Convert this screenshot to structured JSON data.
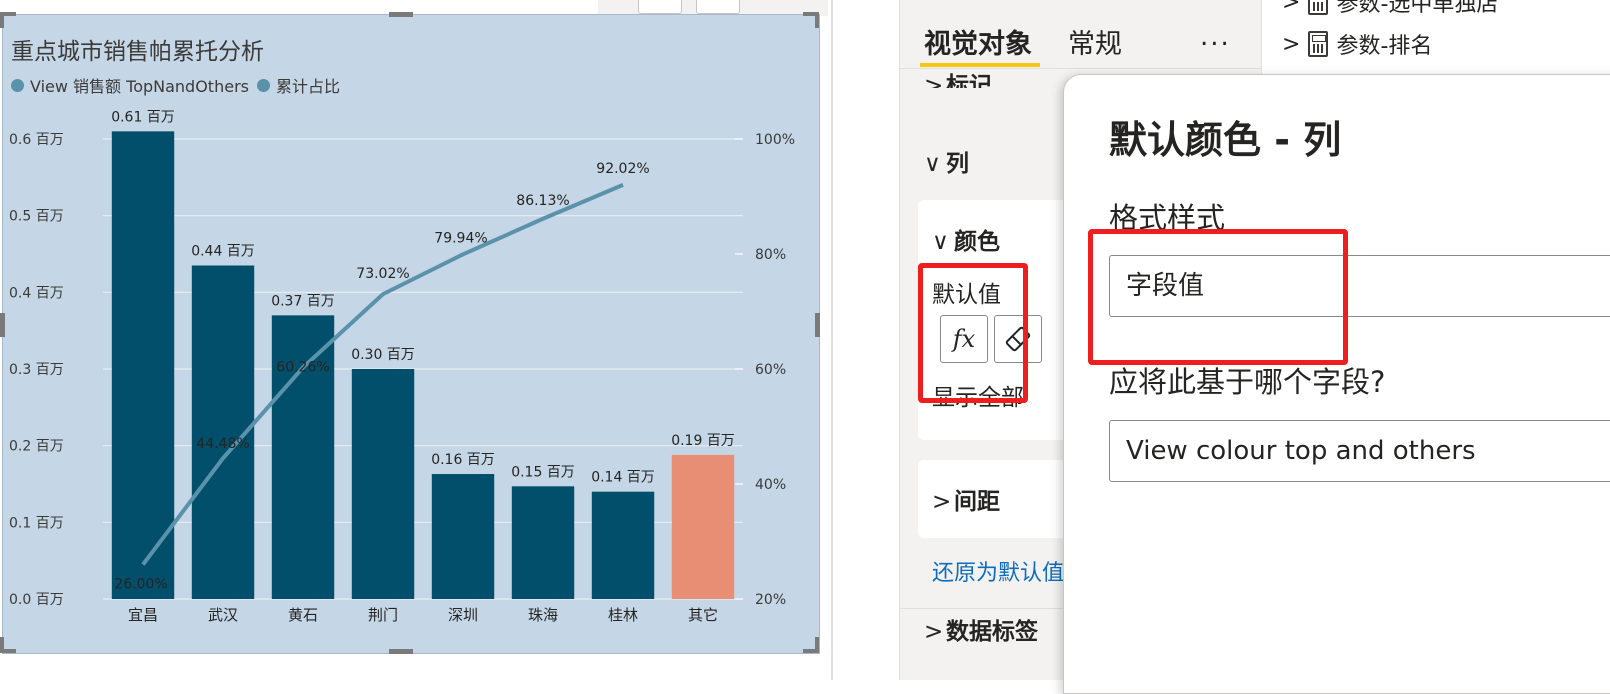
{
  "chart_data": {
    "type": "bar",
    "title": "重点城市销售帕累托分析",
    "categories": [
      "宜昌",
      "武汉",
      "黄石",
      "荆门",
      "深圳",
      "珠海",
      "桂林",
      "其它"
    ],
    "series": [
      {
        "name": "View 销售额 TopNandOthers",
        "values": [
          0.61,
          0.435,
          0.37,
          0.3,
          0.163,
          0.147,
          0.14,
          0.188
        ],
        "data_labels": [
          "0.61 百万",
          "0.44 百万",
          "0.37 百万",
          "0.30 百万",
          "0.16 百万",
          "0.15 百万",
          "0.14 百万",
          "0.19 百万"
        ],
        "colors": [
          "#014f6b",
          "#014f6b",
          "#014f6b",
          "#014f6b",
          "#014f6b",
          "#014f6b",
          "#014f6b",
          "#e88e74"
        ]
      },
      {
        "name": "累计占比",
        "type": "line",
        "axis": "right",
        "values": [
          26.0,
          44.48,
          60.26,
          73.02,
          79.94,
          86.13,
          92.02
        ],
        "data_labels": [
          "26.00%",
          "44.48%",
          "60.26%",
          "73.02%",
          "79.94%",
          "86.13%",
          "92.02%"
        ],
        "color": "#5a92ab"
      }
    ],
    "y_left": {
      "ylim": [
        0,
        0.6
      ],
      "ticks": [
        "0.0 百万",
        "0.1 百万",
        "0.2 百万",
        "0.3 百万",
        "0.4 百万",
        "0.5 百万",
        "0.6 百万"
      ]
    },
    "y_right": {
      "ylim": [
        20,
        100
      ],
      "ticks": [
        "20%",
        "40%",
        "60%",
        "80%",
        "100%"
      ]
    },
    "legend_position": "top-left",
    "grid": true,
    "legend_dot_color": "#5a92ab"
  },
  "report": {
    "toolbar_buttons": [
      "",
      ""
    ]
  },
  "format_pane": {
    "tabs": {
      "visual": "视觉对象",
      "general": "常规"
    },
    "more": "...",
    "partial_section": "标记",
    "column_section": "列",
    "color_section": "颜色",
    "default_value_label": "默认值",
    "fx_label": "fx",
    "show_all": "显示全部",
    "spacing_section": "间距",
    "reset_link": "还原为默认值",
    "data_labels_section": "数据标签"
  },
  "fields": {
    "item1": "参数-选中单独店",
    "item2": "参数-排名"
  },
  "popup": {
    "title": "默认颜色 - 列",
    "format_style_label": "格式样式",
    "format_style_value": "字段值",
    "based_on_label": "应将此基于哪个字段?",
    "based_on_value": "View colour top and others"
  },
  "colors": {
    "bar": "#014f6b",
    "others_bar": "#e88e74",
    "line": "#5a92ab",
    "visual_bg": "#c5d6e6",
    "highlight": "#ef1e1e",
    "accent_tab": "#f2c811"
  }
}
